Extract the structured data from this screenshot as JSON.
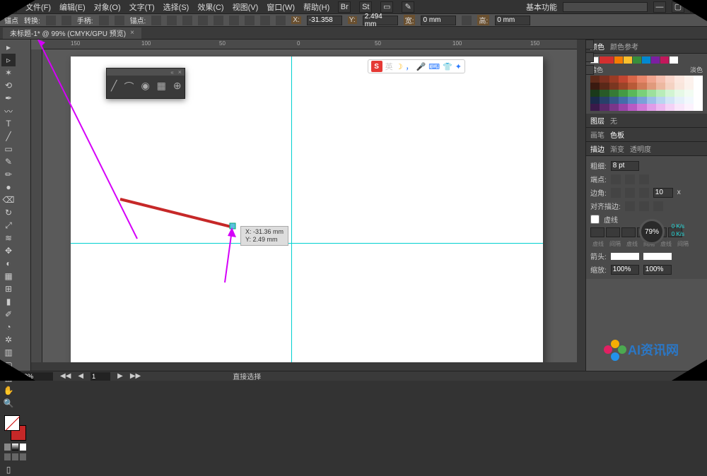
{
  "menu": {
    "items": [
      "文件(F)",
      "编辑(E)",
      "对象(O)",
      "文字(T)",
      "选择(S)",
      "效果(C)",
      "视图(V)",
      "窗口(W)",
      "帮助(H)"
    ],
    "workspace": "基本功能"
  },
  "propbar": {
    "label_anchor": "锚点",
    "label_convert": "转换:",
    "label_handle": "手柄:",
    "label_anchors": "锚点:",
    "x_label": "X:",
    "x_val": "-31.358",
    "y_label": "Y:",
    "y_val": "2.494 mm",
    "w_label": "宽:",
    "w_val": "0 mm",
    "h_label": "高:",
    "h_val": "0 mm"
  },
  "tab": {
    "title": "未标题-1* @ 99% (CMYK/GPU 预览)"
  },
  "ruler": {
    "marks": [
      "150",
      "100",
      "50",
      "0",
      "50",
      "100",
      "150"
    ]
  },
  "canvas": {
    "coord_x": "X: -31.36 mm",
    "coord_y": "Y: 2.49 mm"
  },
  "ime": {
    "logo": "S",
    "lang": "英"
  },
  "panels": {
    "color_tab1": "颜色",
    "color_tab2": "颜色参考",
    "tint_label_l": "暗色",
    "tint_label_r": "淡色",
    "layers_tab": "图层",
    "layers_none": "无",
    "brush_tab": "画笔",
    "swatch_tab": "色板",
    "stroke_tab": "描边",
    "grad_tab": "渐变",
    "opacity_tab": "透明度",
    "weight_label": "粗细:",
    "weight_val": "8 pt",
    "cap_label": "端点:",
    "corner_label": "边角:",
    "limit_val": "10",
    "align_label": "对齐描边:",
    "dashed": "虚线",
    "dash": "虚线",
    "gap": "间隔",
    "arrow_label": "箭头:",
    "scale_label": "缩放:",
    "scale_val": "100%",
    "knob": "79%",
    "net_rate": "0 K/s"
  },
  "status": {
    "zoom": "99%",
    "nav": "1",
    "tool": "直接选择"
  },
  "watermark": {
    "text": "AI资讯网"
  }
}
